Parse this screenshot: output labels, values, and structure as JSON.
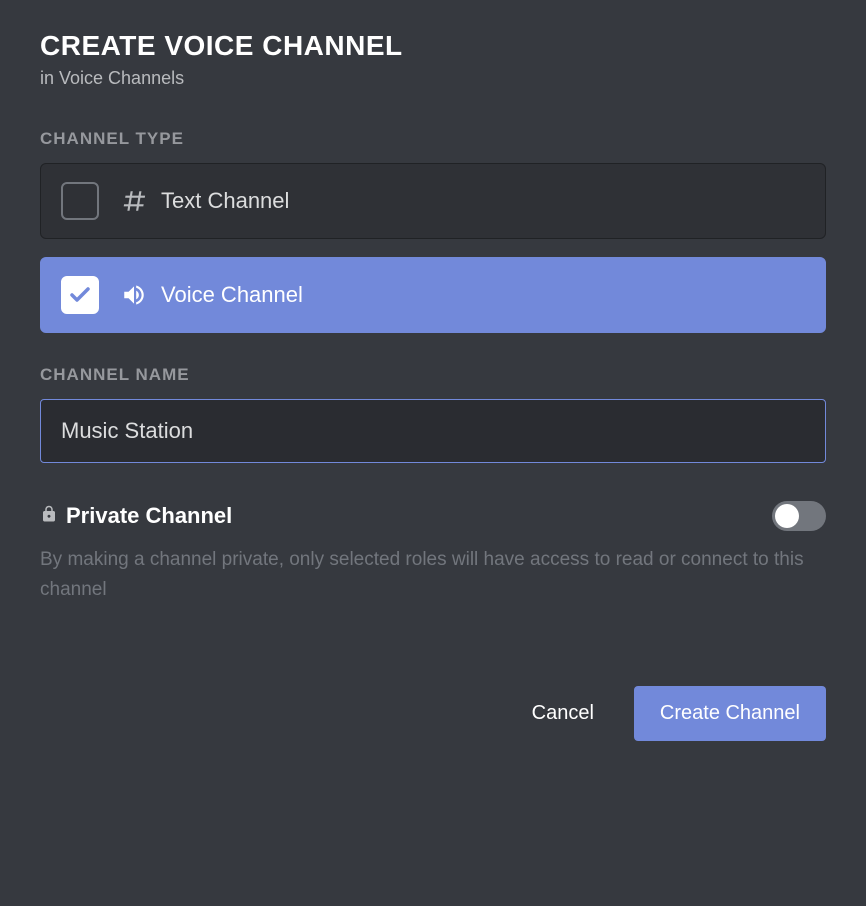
{
  "header": {
    "title": "CREATE VOICE CHANNEL",
    "subtitle": "in Voice Channels"
  },
  "channelType": {
    "label": "CHANNEL TYPE",
    "options": [
      {
        "label": "Text Channel",
        "selected": false
      },
      {
        "label": "Voice Channel",
        "selected": true
      }
    ]
  },
  "channelName": {
    "label": "CHANNEL NAME",
    "value": "Music Station"
  },
  "privateChannel": {
    "label": "Private Channel",
    "enabled": false,
    "description": "By making a channel private, only selected roles will have access to read or connect to this channel"
  },
  "footer": {
    "cancel": "Cancel",
    "create": "Create Channel"
  }
}
